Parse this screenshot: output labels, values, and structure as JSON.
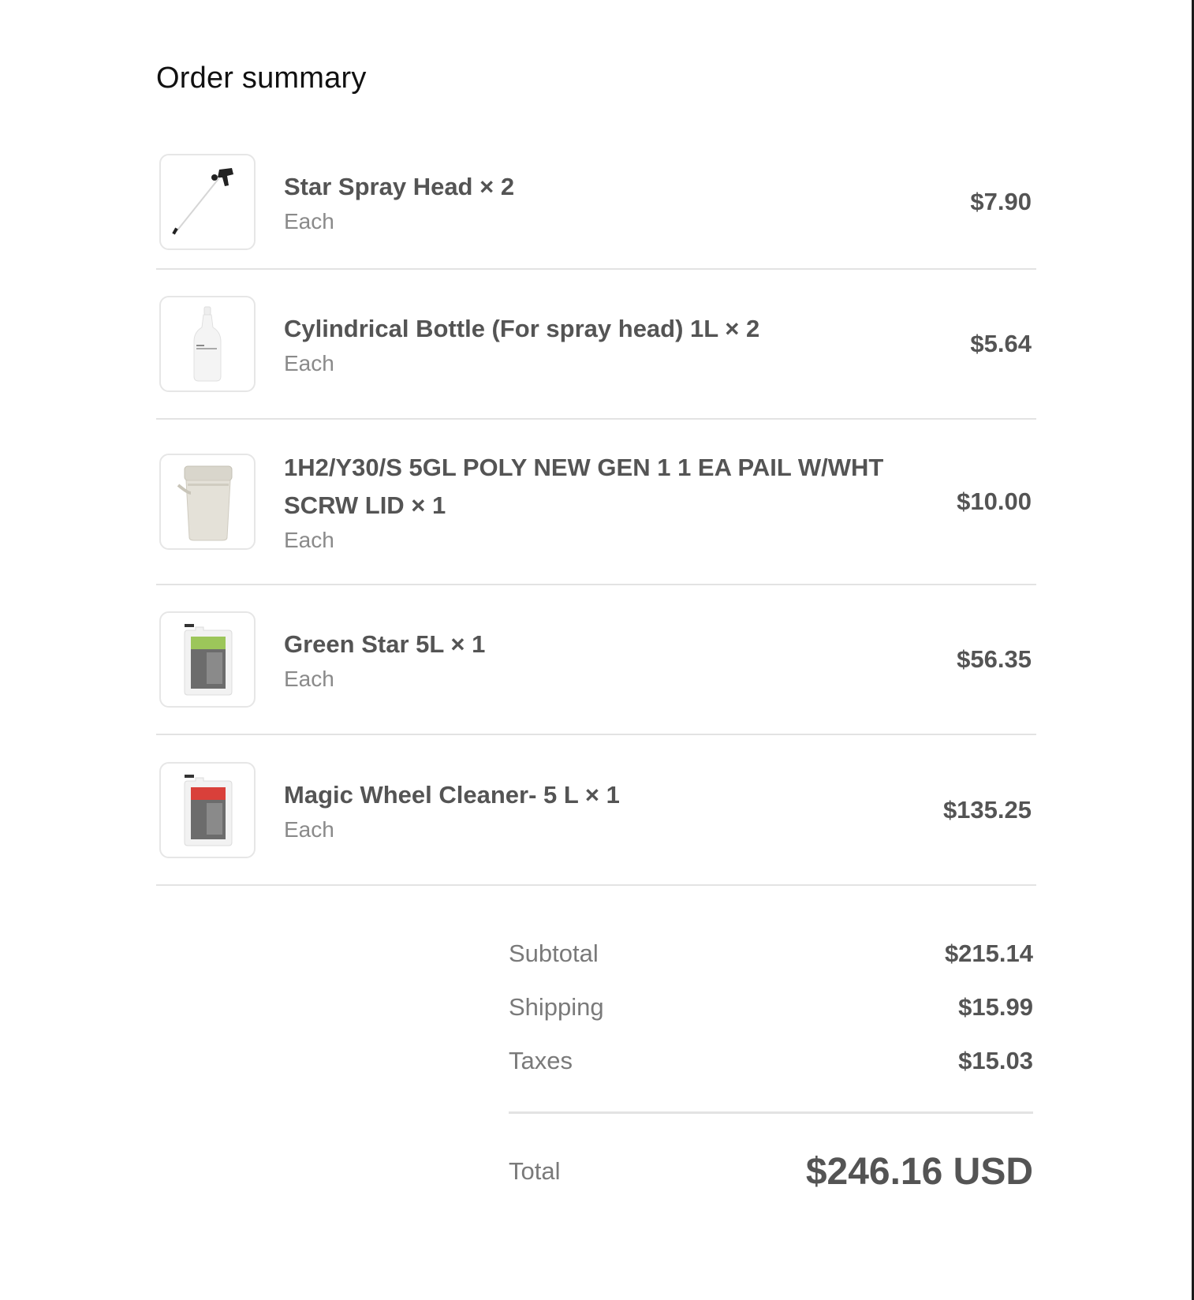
{
  "title": "Order summary",
  "items": [
    {
      "name": "Star Spray Head × 2",
      "unit": "Each",
      "price": "$7.90",
      "thumb_icon": "spray-head-icon"
    },
    {
      "name": "Cylindrical Bottle (For spray head) 1L × 2",
      "unit": "Each",
      "price": "$5.64",
      "thumb_icon": "bottle-icon"
    },
    {
      "name": "1H2/Y30/S 5GL POLY NEW GEN 1 1 EA PAIL W/WHT SCRW LID × 1",
      "unit": "Each",
      "price": "$10.00",
      "thumb_icon": "pail-icon"
    },
    {
      "name": "Green Star 5L × 1",
      "unit": "Each",
      "price": "$56.35",
      "thumb_icon": "green-canister-icon"
    },
    {
      "name": "Magic Wheel Cleaner- 5 L × 1",
      "unit": "Each",
      "price": "$135.25",
      "thumb_icon": "red-canister-icon"
    }
  ],
  "totals": {
    "subtotal_label": "Subtotal",
    "subtotal_value": "$215.14",
    "shipping_label": "Shipping",
    "shipping_value": "$15.99",
    "taxes_label": "Taxes",
    "taxes_value": "$15.03",
    "total_label": "Total",
    "total_value": "$246.16 USD"
  },
  "colors": {
    "text": "#545454",
    "muted": "#8a8a8a",
    "divider": "#e3e3e3",
    "green_label": "#9cc65a",
    "red_label": "#d9403a"
  }
}
